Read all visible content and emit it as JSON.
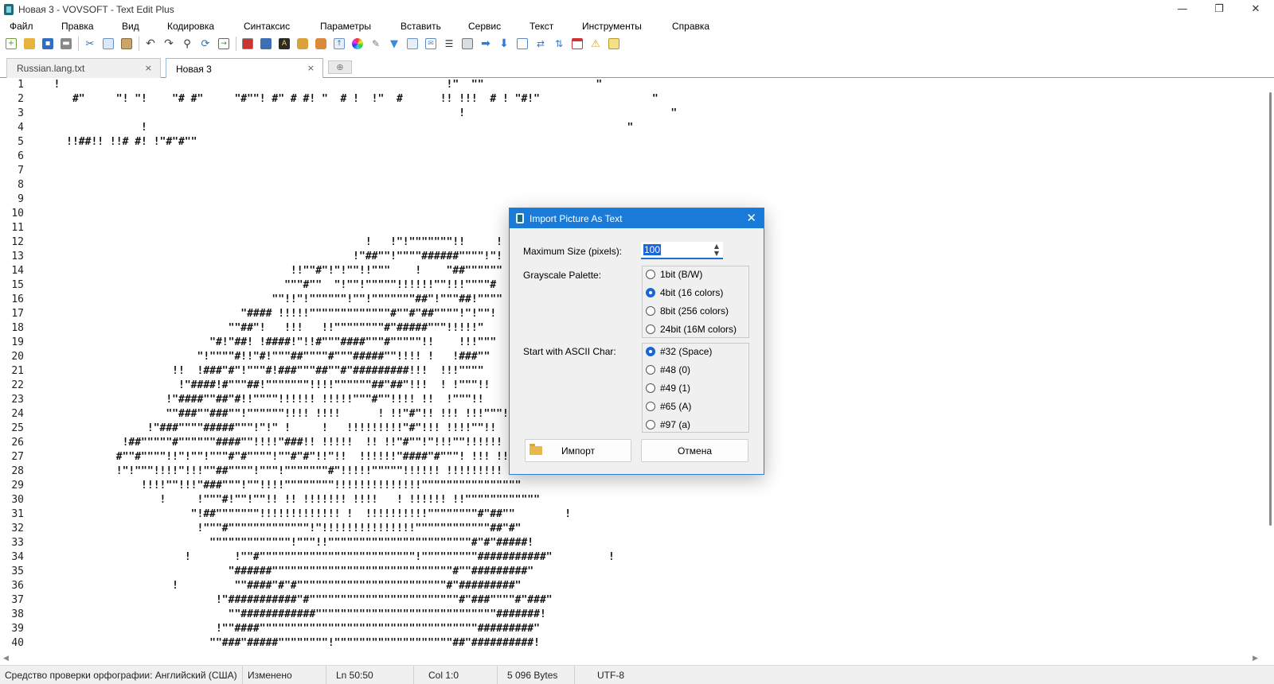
{
  "window": {
    "title": "Новая 3 - VOVSOFT - Text Edit Plus",
    "controls": {
      "minimize": "—",
      "restore": "❐",
      "close": "✕"
    }
  },
  "menu": [
    "Файл",
    "Правка",
    "Вид",
    "Кодировка",
    "Синтаксис",
    "Параметры",
    "Вставить",
    "Сервис",
    "Текст",
    "Инструменты",
    "Справка"
  ],
  "toolbar_icons": [
    "new-file-icon",
    "open-folder-icon",
    "save-icon",
    "print-icon",
    "cut-icon",
    "copy-icon",
    "paste-icon",
    "undo-icon",
    "redo-icon",
    "find-icon",
    "replace-icon",
    "goto-icon",
    "image-icon",
    "screen-icon",
    "text-art-icon",
    "lock-icon",
    "unlock-icon",
    "export-icon",
    "color-wheel-icon",
    "pen-icon",
    "filter-icon",
    "table-icon",
    "mail-icon",
    "list-icon",
    "keyboard-icon",
    "arrow-right-icon",
    "arrow-down-icon",
    "window-icon",
    "convert-icon",
    "transform-icon",
    "calendar-icon",
    "warning-icon",
    "note-icon"
  ],
  "tabs": [
    {
      "label": "Russian.lang.txt",
      "active": false
    },
    {
      "label": "Новая 3",
      "active": true
    }
  ],
  "tab_close": "×",
  "tab_new": "⊕",
  "editor": {
    "line_numbers": [
      "1",
      "2",
      "3",
      "4",
      "5",
      "6",
      "7",
      "8",
      "9",
      "10",
      "11",
      "12",
      "13",
      "14",
      "15",
      "16",
      "17",
      "18",
      "19",
      "20",
      "21",
      "22",
      "23",
      "24",
      "25",
      "26",
      "27",
      "28",
      "29",
      "30",
      "31",
      "32",
      "33",
      "34",
      "35",
      "36",
      "37",
      "38",
      "39",
      "40"
    ],
    "lines": [
      "   !                                                              !\"  \"\"                  \"",
      "      #\"     \"! \"!    \"# #\"     \"#\"\"! #\" # #! \"  # !  !\"  #      !! !!!  # ! \"#!\"                  \"",
      "                                                                    !                                 \"",
      "                 !                                                                             \"",
      "     !!##!! !!# #! !\"#\"#\"\"",
      "",
      "",
      "",
      "",
      "",
      "",
      "                                                     !   !\"!\"\"\"\"\"\"\"!!     !",
      "                                                   !\"##\"\"!\"\"\"\"######\"\"\"\"!\"!",
      "                                         !!\"\"#\"!\"!\"\"!!\"\"\"    !    \"##\"\"\"\"\"\"",
      "                                        \"\"\"#\"\"  \"!\"\"!\"\"\"\"\"!!!!!!\"\"!!!\"\"\"\"#",
      "                                      \"\"!!\"!\"\"\"\"\"\"!\"\"!\"\"\"\"\"\"\"##\"!\"\"\"##!\"\"\"\"",
      "                                 \"#### !!!!!\"\"\"\"\"\"\"\"\"\"\"\"\"#\"\"#\"##\"\"\"\"!\"!\"\"!",
      "                               \"\"##\"!   !!!   !!\"\"\"\"\"\"\"\"#\"#####\"\"\"!!!!!\"",
      "                            \"#!\"##! !####!\"!!#\"\"\"####\"\"\"#\"\"\"\"\"!!    !!!\"\"\"",
      "                          \"!\"\"\"\"#!!\"#!\"\"\"##\"\"\"\"#\"\"\"#####\"\"!!!! !   !###\"\"",
      "                      !!  !###\"#\"!\"\"\"#!###\"\"\"##\"\"#\"#########!!!  !!!\"\"\"\"",
      "                       !\"####!#\"\"\"##!\"\"\"\"\"\"\"!!!!\"\"\"\"\"\"##\"##\"!!!  ! !\"\"\"!!",
      "                     !\"####\"\"##\"#!!\"\"\"\"!!!!!! !!!!!\"\"\"#\"\"!!!! !!  !\"\"\"!!",
      "                     \"\"###\"\"###\"\"!\"\"\"\"\"\"!!!! !!!!      ! !!\"#\"!! !!! !!!\"\"\"!!!",
      "                  !\"###\"\"\"\"#####\"\"\"!\"!\" !     !   !!!!!!!!!\"#\"!!! !!!!\"\"!!  !",
      "              !##\"\"\"\"\"#\"\"\"\"\"\"####\"\"!!!!\"###!! !!!!!  !! !!\"#\"\"!\"!!!\"\"!!!!!!",
      "             #\"\"#\"\"\"\"!!\"!\"\"!\"\"\"#\"#\"\"\"\"!\"\"#\"#\"!!\"!!  !!!!!!\"####\"#\"\"\"! !!! !!!",
      "             !\"!\"\"\"!!!!\"!!!\"\"##\"\"\"\"!\"\"\"!\"\"\"\"\"\"\"#\"!!!!!\"\"\"\"\"!!!!!! !!!!!!!!!",
      "                 !!!!\"\"!!!\"###\"\"\"!\"\"!!!!\"\"\"\"\"\"\"\"!!!!!!!!!!!!!!\"\"\"\"\"\"\"\"\"\"\"\"\"\"\"\"",
      "                    !     !\"\"\"#!\"\"!\"\"!! !! !!!!!!! !!!!   ! !!!!!! !!\"\"\"\"\"\"\"\"\"\"\"\"",
      "                         \"!##\"\"\"\"\"\"\"!!!!!!!!!!!!! !  !!!!!!!!!!\"\"\"\"\"\"\"\"#\"##\"\"        !",
      "                          !\"\"\"#\"\"\"\"\"\"\"\"\"\"\"\"\"!\"!!!!!!!!!!!!!!!\"\"\"\"\"\"\"\"\"\"\"\"##\"#\"",
      "                            \"\"\"\"\"\"\"\"\"\"\"\"\"!\"\"\"!!\"\"\"\"\"\"\"\"\"\"\"\"\"\"\"\"\"\"\"\"\"\"\"#\"#\"#####!",
      "                        !       !\"\"#\"\"\"\"\"\"\"\"\"\"\"\"\"\"\"\"\"\"\"\"\"\"\"\"\"!\"\"\"\"\"\"\"\"\"###########\"         !",
      "                               \"######\"\"\"\"\"\"\"\"\"\"\"\"\"\"\"\"\"\"\"\"\"\"\"\"\"\"\"\"\"#\"\"#########\"",
      "                      !         \"\"####\"#\"#\"\"\"\"\"\"\"\"\"\"\"\"\"\"\"\"\"\"\"\"\"\"\"\"#\"#########\"",
      "                             !\"###########\"#\"\"\"\"\"\"\"\"\"\"\"\"\"\"\"\"\"\"\"\"\"\"\"\"#\"###\"\"\"\"#\"###\"",
      "                               \"\"############\"\"\"\"\"\"\"\"\"\"\"\"\"\"\"\"\"\"\"\"\"\"\"\"\"\"\"\"\"#######!",
      "                             !\"\"####\"\"\"\"\"\"\"\"\"\"\"\"\"\"\"\"\"\"\"\"\"\"\"\"\"\"\"\"\"\"\"\"\"\"\"#########\"",
      "                            \"\"###\"#####\"\"\"\"\"\"\"\"!\"\"\"\"\"\"\"\"\"\"\"\"\"\"\"\"\"\"\"##\"##########!"
    ]
  },
  "statusbar": {
    "spellcheck": "Средство проверки орфографии: Английский (США)",
    "modified": "Изменено",
    "line": "Ln 50:50",
    "col": "Col 1:0",
    "size": "5 096 Bytes",
    "encoding": "UTF-8"
  },
  "dialog": {
    "title": "Import Picture As Text",
    "close": "✕",
    "max_size_label": "Maximum Size (pixels):",
    "max_size_value": "100",
    "spin_up": "▲",
    "spin_down": "▼",
    "palette_label": "Grayscale Palette:",
    "palette_options": [
      {
        "label": "1bit (B/W)",
        "checked": false
      },
      {
        "label": "4bit (16 colors)",
        "checked": true
      },
      {
        "label": "8bit (256 colors)",
        "checked": false
      },
      {
        "label": "24bit (16M colors)",
        "checked": false
      }
    ],
    "ascii_label": "Start with ASCII Char:",
    "ascii_options": [
      {
        "label": "#32 (Space)",
        "checked": true
      },
      {
        "label": "#48 (0)",
        "checked": false
      },
      {
        "label": "#49 (1)",
        "checked": false
      },
      {
        "label": "#65 (A)",
        "checked": false
      },
      {
        "label": "#97 (a)",
        "checked": false
      }
    ],
    "import_button": "Импорт",
    "cancel_button": "Отмена"
  },
  "colors": {
    "accent": "#1a7ad8",
    "selection": "#1a66d4"
  }
}
